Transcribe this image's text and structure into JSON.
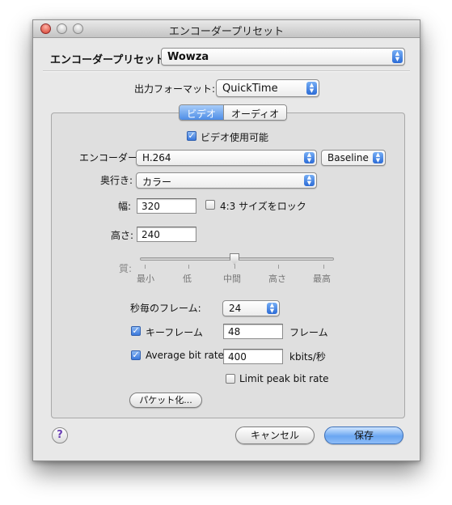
{
  "window": {
    "title": "エンコーダープリセット"
  },
  "preset": {
    "label": "エンコーダープリセット:",
    "value": "Wowza"
  },
  "output_format": {
    "label": "出力フォーマット:",
    "value": "QuickTime"
  },
  "tabs": [
    {
      "label": "ビデオ",
      "active": true
    },
    {
      "label": "オーディオ",
      "active": false
    }
  ],
  "video": {
    "enable_checkbox": {
      "label": "ビデオ使用可能",
      "checked": true
    },
    "encoder": {
      "label": "エンコーダー:",
      "value": "H.264",
      "profile": "Baseline"
    },
    "depth": {
      "label": "奥行き:",
      "value": "カラー"
    },
    "width": {
      "label": "幅:",
      "value": "320"
    },
    "lock_ratio": {
      "label": "4:3 サイズをロック",
      "checked": false
    },
    "height": {
      "label": "高さ:",
      "value": "240"
    },
    "quality": {
      "label": "質:",
      "ticks": [
        "最小",
        "低",
        "中間",
        "高さ",
        "最高"
      ],
      "selected": "中間"
    },
    "fps": {
      "label": "秒毎のフレーム:",
      "value": "24"
    },
    "keyframe": {
      "label": "キーフレーム",
      "checked": true,
      "value": "48",
      "unit": "フレーム"
    },
    "bitrate": {
      "label": "Average bit rate:",
      "checked": true,
      "value": "400",
      "unit": "kbits/秒"
    },
    "limit_peak": {
      "label": "Limit peak bit rate",
      "checked": false
    },
    "packetize_button": "パケット化..."
  },
  "footer": {
    "help_glyph": "?",
    "cancel_label": "キャンセル",
    "save_label": "保存"
  },
  "colors": {
    "accent": "#4d8de6",
    "window_bg": "#e8e8e8"
  }
}
